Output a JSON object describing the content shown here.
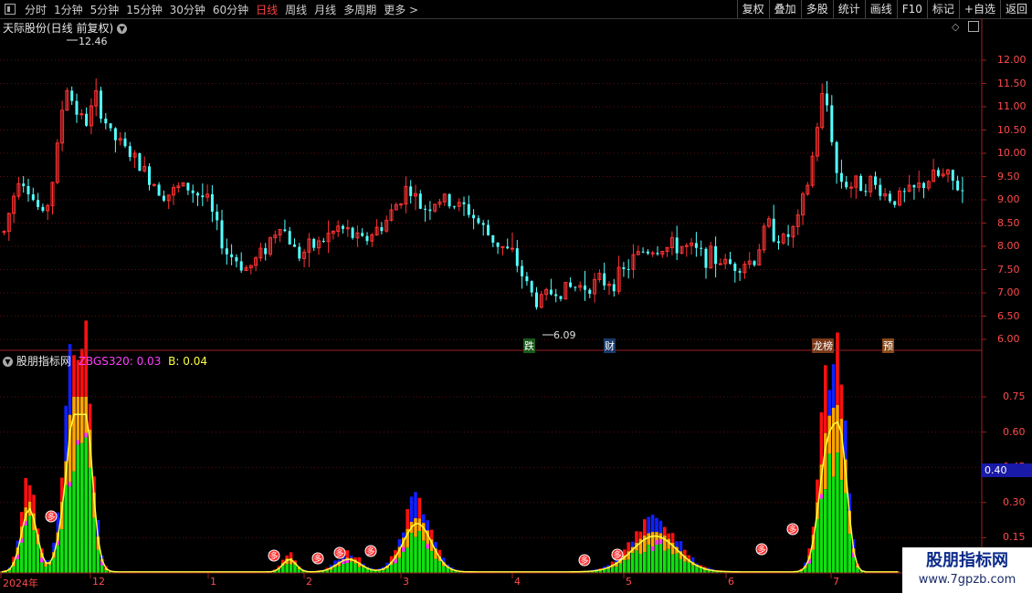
{
  "toolbar": {
    "items": [
      "分时",
      "1分钟",
      "5分钟",
      "15分钟",
      "30分钟",
      "60分钟",
      "日线",
      "周线",
      "月线",
      "多周期",
      "更多 >"
    ],
    "right": [
      "复权",
      "叠加",
      "多股",
      "统计",
      "画线",
      "F10",
      "标记",
      "+自选",
      "返回"
    ]
  },
  "main_title": "天际股份(日线 前复权)",
  "max_label": "12.46",
  "min_label": "6.09",
  "events": [
    "跌",
    "财",
    "龙榜",
    "预"
  ],
  "price_axis": [
    "12.00",
    "11.50",
    "11.00",
    "10.50",
    "10.00",
    "9.50",
    "9.00",
    "8.50",
    "8.00",
    "7.50",
    "7.00",
    "6.50",
    "6.00"
  ],
  "indicator": {
    "name": "股朋指标网",
    "l1": "ZBGS320:",
    "v1": "0.03",
    "l2": "B:",
    "v2": "0.04"
  },
  "ind_axis": [
    "0.75",
    "0.60",
    "0.45",
    "0.30",
    "0.15"
  ],
  "current_value": "0.40",
  "date_labels": [
    "2024年",
    "12",
    "1",
    "2",
    "3",
    "4",
    "5",
    "6",
    "7"
  ],
  "signal_glyph": "多",
  "watermark": {
    "name": "股朋指标网",
    "url": "www.7gpzb.com"
  },
  "colors": {
    "up": "#ff3232",
    "down": "#54ffff",
    "ind_red": "#ff1010",
    "ind_blue": "#1020ff",
    "ind_orange": "#ffa500",
    "ind_green": "#10e010",
    "ind_magenta": "#ff30ff",
    "ind_line": "#ffff40"
  },
  "chart_data": [
    {
      "type": "candlestick",
      "title": "天际股份(日线 前复权)",
      "x": [
        "2024-11",
        "2024-12",
        "2025-01",
        "2025-02",
        "2025-03",
        "2025-04",
        "2025-05",
        "2025-06",
        "2025-07"
      ],
      "close_approx": [
        8.5,
        11.0,
        8.0,
        8.3,
        8.8,
        6.8,
        7.9,
        7.9,
        9.1
      ],
      "max": 12.46,
      "min": 6.09,
      "ylim": [
        6.0,
        12.0
      ]
    },
    {
      "type": "bar",
      "title": "股朋指标网",
      "series": [
        {
          "name": "ZBGS320",
          "last": 0.03
        },
        {
          "name": "B",
          "last": 0.04
        }
      ],
      "ylim": [
        0.0,
        0.8
      ]
    }
  ]
}
